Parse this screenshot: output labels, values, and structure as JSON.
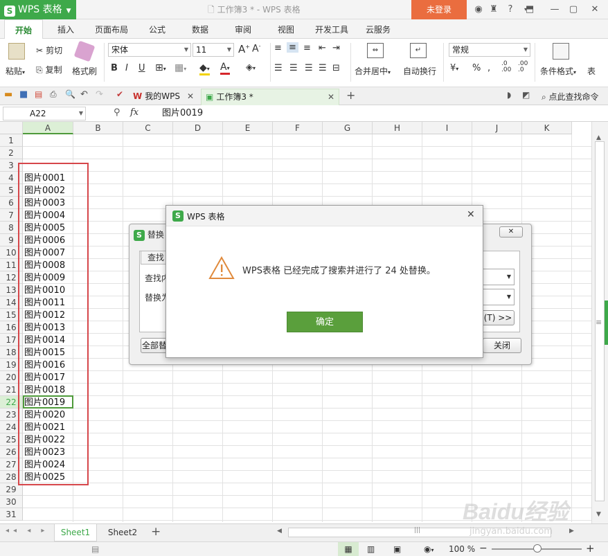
{
  "titlebar": {
    "app_label": "WPS 表格",
    "app_logo": "S",
    "doc_title": "工作簿3 * - WPS 表格",
    "login_label": "未登录"
  },
  "ribbon_tabs": [
    "开始",
    "插入",
    "页面布局",
    "公式",
    "数据",
    "审阅",
    "视图",
    "开发工具",
    "云服务"
  ],
  "ribbon": {
    "paste": "粘贴",
    "cut": "剪切",
    "copy": "复制",
    "format_painter": "格式刷",
    "font_name": "宋体",
    "font_size": "11",
    "merge_center": "合并居中",
    "wrap_text": "自动换行",
    "number_format": "常规",
    "cond_format": "条件格式",
    "table_style": "表"
  },
  "doc_tabs": {
    "home": "我的WPS",
    "workbook": "工作簿3 *",
    "search_cmd": "点此查找命令"
  },
  "formula_bar": {
    "name_box": "A22",
    "fx": "fx",
    "value": "图片0019"
  },
  "columns": [
    "A",
    "B",
    "C",
    "D",
    "E",
    "F",
    "G",
    "H",
    "I",
    "J",
    "K"
  ],
  "rows": [
    "1",
    "2",
    "3",
    "4",
    "5",
    "6",
    "7",
    "8",
    "9",
    "10",
    "11",
    "12",
    "13",
    "14",
    "15",
    "16",
    "17",
    "18",
    "19",
    "20",
    "21",
    "22",
    "23",
    "24",
    "25",
    "26",
    "27",
    "28",
    "29",
    "30",
    "31"
  ],
  "cells": [
    "图片0001",
    "图片0002",
    "图片0003",
    "图片0004",
    "图片0005",
    "图片0006",
    "图片0007",
    "图片0008",
    "图片0009",
    "图片0010",
    "图片0011",
    "图片0012",
    "图片0013",
    "图片0014",
    "图片0015",
    "图片0016",
    "图片0017",
    "图片0018",
    "图片0019",
    "图片0020",
    "图片0021",
    "图片0022",
    "图片0023",
    "图片0024",
    "图片0025"
  ],
  "sheets": {
    "sheet1": "Sheet1",
    "sheet2": "Sheet2"
  },
  "status": {
    "zoom": "100 %"
  },
  "replace_dialog": {
    "title": "替换",
    "tab_find": "查找",
    "find_label": "查找内",
    "replace_label": "替换为",
    "options_btn": "(T) >>",
    "replace_all": "全部替",
    "close": "关闭"
  },
  "message_dialog": {
    "title": "WPS 表格",
    "message": "WPS表格 已经完成了搜索并进行了 24 处替换。",
    "ok": "确定"
  },
  "watermark": {
    "brand": "Baidu经验",
    "url": "jingyan.baidu.com"
  },
  "colors": {
    "accent_green": "#3ea94a",
    "login_orange": "#ea6d3f",
    "highlight_red": "#d6464a"
  }
}
